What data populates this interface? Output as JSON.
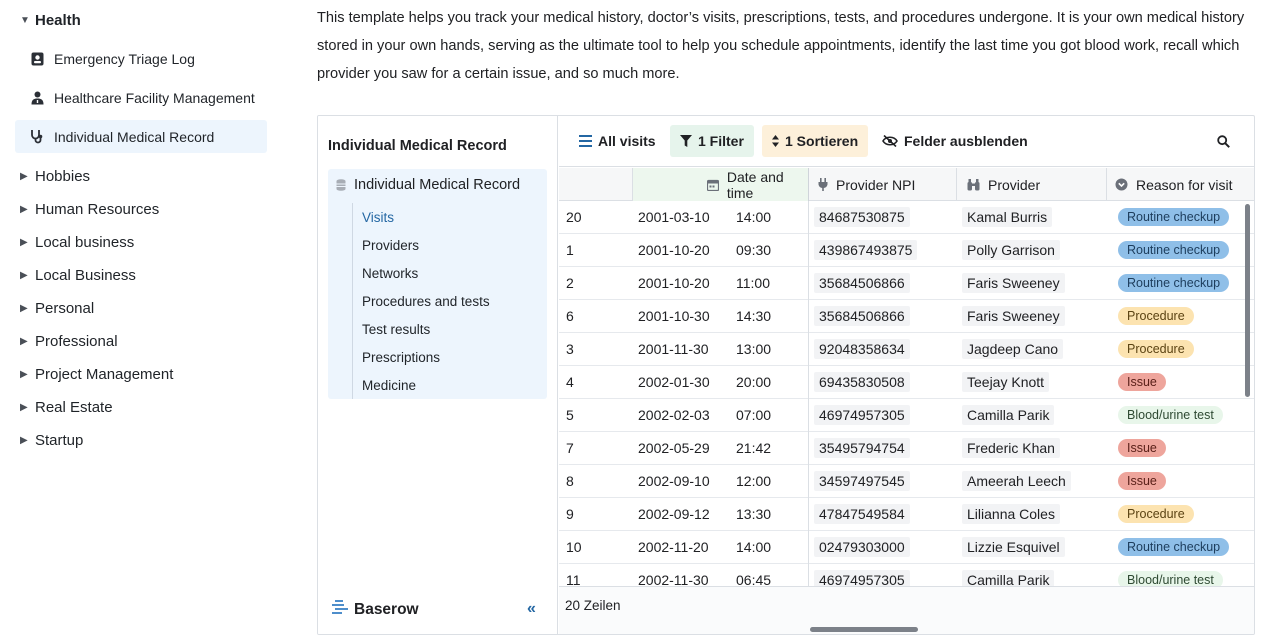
{
  "sidebar": {
    "categories_top": {
      "label": "Health"
    },
    "templates": [
      {
        "label": "Emergency Triage Log",
        "icon": "contact-card-icon"
      },
      {
        "label": "Healthcare Facility Management",
        "icon": "user-doctor-icon"
      },
      {
        "label": "Individual Medical Record",
        "icon": "stethoscope-icon",
        "active": true
      }
    ],
    "categories": [
      "Hobbies",
      "Human Resources",
      "Local business",
      "Local Business",
      "Personal",
      "Professional",
      "Project Management",
      "Real Estate",
      "Startup"
    ]
  },
  "description": "This template helps you track your medical history, doctor’s visits, prescriptions, tests, and procedures undergone. It is your own medical history stored in your own hands, serving as the ultimate tool to help you schedule appointments, identify the last time you got blood work, recall which provider you saw for a certain issue, and so much more.",
  "preview": {
    "sidebar": {
      "title": "Individual Medical Record",
      "database": "Individual Medical Record",
      "tables": [
        "Visits",
        "Providers",
        "Networks",
        "Procedures and tests",
        "Test results",
        "Prescriptions",
        "Medicine"
      ],
      "active_table": "Visits",
      "brand": "Baserow"
    },
    "toolbar": {
      "views": "All visits",
      "filter": "1 Filter",
      "sort": "1 Sortieren",
      "hide": "Felder ausblenden"
    },
    "grid": {
      "columns": {
        "date": "Date and time",
        "npi": "Provider NPI",
        "provider": "Provider",
        "reason": "Reason for visit"
      },
      "rows": [
        {
          "id": "20",
          "date": "2001-03-10",
          "time": "14:00",
          "npi": "84687530875",
          "provider": "Kamal Burris",
          "reason": "Routine checkup"
        },
        {
          "id": "1",
          "date": "2001-10-20",
          "time": "09:30",
          "npi": "439867493875",
          "provider": "Polly Garrison",
          "reason": "Routine checkup"
        },
        {
          "id": "2",
          "date": "2001-10-20",
          "time": "11:00",
          "npi": "35684506866",
          "provider": "Faris Sweeney",
          "reason": "Routine checkup"
        },
        {
          "id": "6",
          "date": "2001-10-30",
          "time": "14:30",
          "npi": "35684506866",
          "provider": "Faris Sweeney",
          "reason": "Procedure"
        },
        {
          "id": "3",
          "date": "2001-11-30",
          "time": "13:00",
          "npi": "92048358634",
          "provider": "Jagdeep Cano",
          "reason": "Procedure"
        },
        {
          "id": "4",
          "date": "2002-01-30",
          "time": "20:00",
          "npi": "69435830508",
          "provider": "Teejay Knott",
          "reason": "Issue"
        },
        {
          "id": "5",
          "date": "2002-02-03",
          "time": "07:00",
          "npi": "46974957305",
          "provider": "Camilla Parik",
          "reason": "Blood/urine test"
        },
        {
          "id": "7",
          "date": "2002-05-29",
          "time": "21:42",
          "npi": "35495794754",
          "provider": "Frederic Khan",
          "reason": "Issue"
        },
        {
          "id": "8",
          "date": "2002-09-10",
          "time": "12:00",
          "npi": "34597497545",
          "provider": "Ameerah Leech",
          "reason": "Issue"
        },
        {
          "id": "9",
          "date": "2002-09-12",
          "time": "13:30",
          "npi": "47847549584",
          "provider": "Lilianna Coles",
          "reason": "Procedure"
        },
        {
          "id": "10",
          "date": "2002-11-20",
          "time": "14:00",
          "npi": "02479303000",
          "provider": "Lizzie Esquivel",
          "reason": "Routine checkup"
        },
        {
          "id": "11",
          "date": "2002-11-30",
          "time": "06:45",
          "npi": "46974957305",
          "provider": "Camilla Parik",
          "reason": "Blood/urine test"
        }
      ],
      "row_count": "20 Zeilen"
    },
    "badge_colors": {
      "Routine checkup": {
        "bg": "#8fbfe8",
        "fg": "#1d3d5c"
      },
      "Procedure": {
        "bg": "#fce3b0",
        "fg": "#5b4313"
      },
      "Issue": {
        "bg": "#eea59c",
        "fg": "#5a2019"
      },
      "Blood/urine test": {
        "bg": "#e8f6ea",
        "fg": "#2f4a33"
      }
    },
    "accent_color": "#2467a3"
  }
}
